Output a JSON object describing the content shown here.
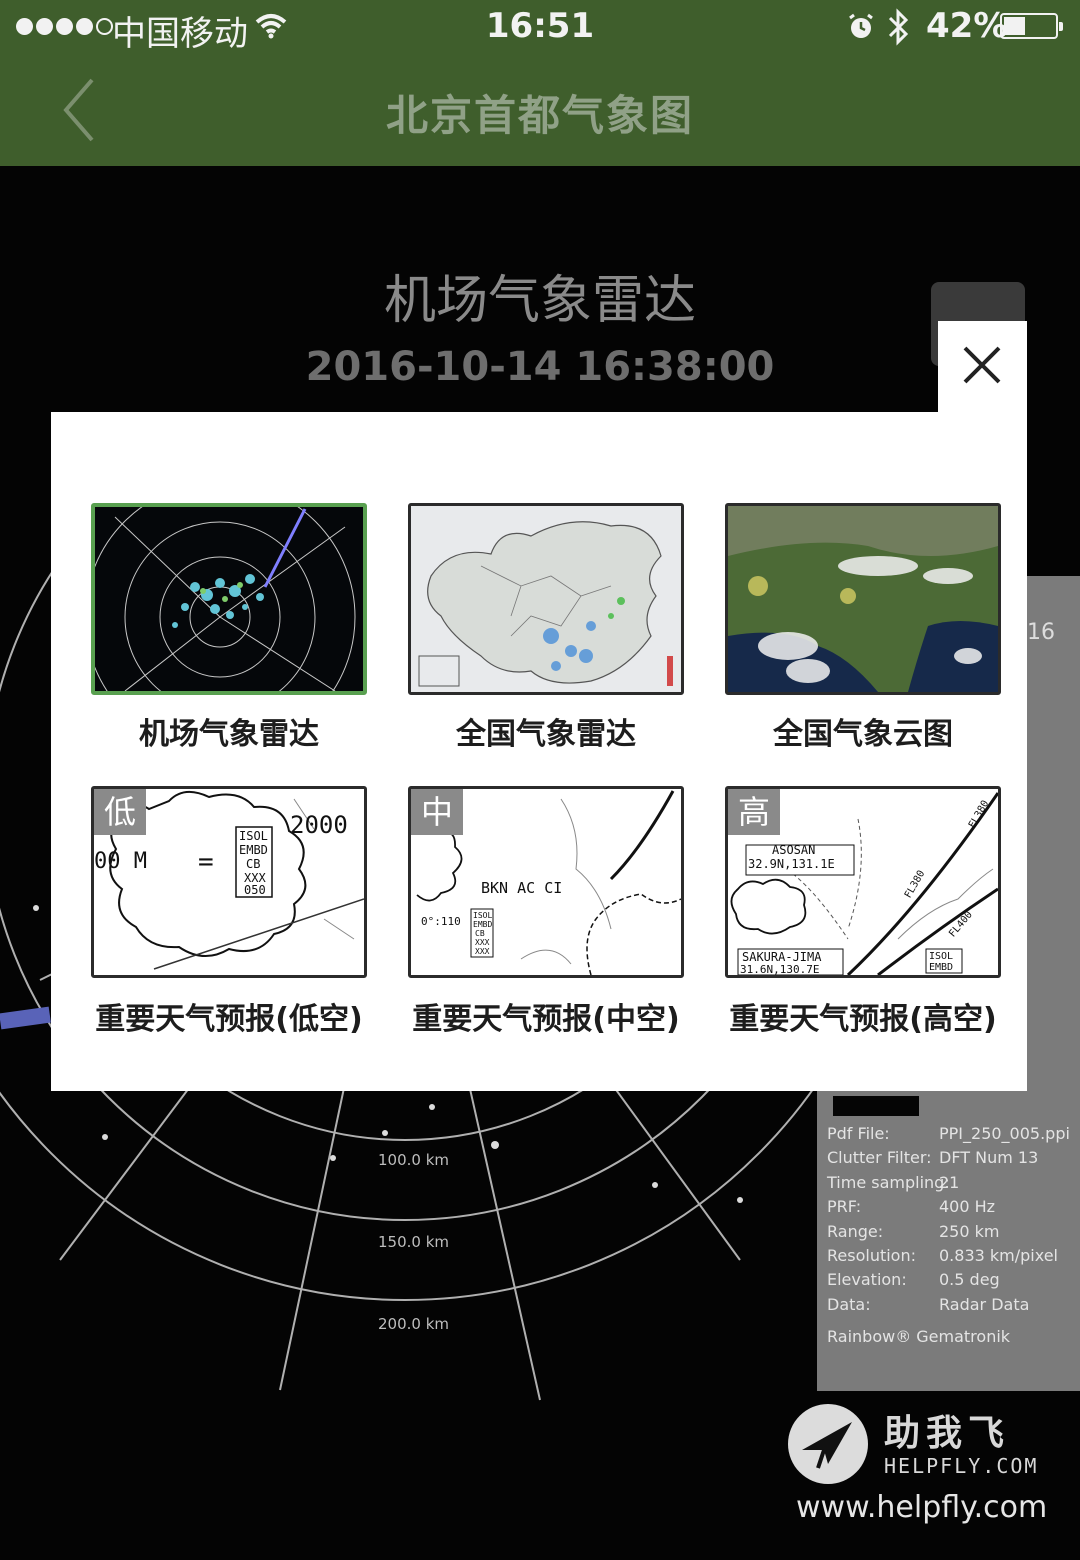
{
  "status_bar": {
    "carrier": "中国移动",
    "time": "16:51",
    "battery_percent_text": "42%",
    "battery_level": 0.42,
    "signal_bars_filled": 4,
    "signal_bars_total": 5
  },
  "nav": {
    "title": "北京首都气象图",
    "back_icon": "chevron-left-icon"
  },
  "background_page": {
    "title": "机场气象雷达",
    "timestamp": "2016-10-14 16:38:00",
    "range_labels": [
      "100.0 km",
      "150.0 km",
      "200.0 km"
    ],
    "info_panel": {
      "partial_number": "16",
      "rows": [
        {
          "key": "Pdf File:",
          "value": "PPI_250_005.ppi"
        },
        {
          "key": "Clutter Filter:",
          "value": "DFT Num 13"
        },
        {
          "key": "Time sampling:",
          "value": "21"
        },
        {
          "key": "PRF:",
          "value": "400 Hz"
        },
        {
          "key": "Range:",
          "value": "250 km"
        },
        {
          "key": "Resolution:",
          "value": "0.833 km/pixel"
        },
        {
          "key": "Elevation:",
          "value": "0.5 deg"
        },
        {
          "key": "Data:",
          "value": "Radar Data"
        }
      ],
      "footer": "Rainbow® Gematronik"
    }
  },
  "modal": {
    "close_icon": "close-icon",
    "items": [
      {
        "label": "机场气象雷达",
        "selected": true,
        "badge": ""
      },
      {
        "label": "全国气象雷达",
        "selected": false,
        "badge": ""
      },
      {
        "label": "全国气象云图",
        "selected": false,
        "badge": ""
      },
      {
        "label": "重要天气预报(低空)",
        "selected": false,
        "badge": "低"
      },
      {
        "label": "重要天气预报(中空)",
        "selected": false,
        "badge": "中"
      },
      {
        "label": "重要天气预报(高空)",
        "selected": false,
        "badge": "高"
      }
    ],
    "chart_texts": {
      "low": {
        "value": "2000",
        "left": "00 M",
        "eq": "=",
        "box": [
          "ISOL",
          "EMBD",
          "CB",
          "XXX",
          "050"
        ]
      },
      "mid": {
        "cloud": "BKN AC CI",
        "coord": "0°:110",
        "box": [
          "ISOL",
          "EMBD",
          "CB",
          "XXX",
          "XXX"
        ]
      },
      "high": {
        "wp1": "ASOSAN",
        "wp1_pos": "32.9N,131.1E",
        "wp2": "SAKURA-JIMA",
        "wp2_pos": "31.6N,130.7E",
        "fl1": "FL380",
        "fl2": "FL380",
        "fl3": "FL400",
        "box": [
          "ISOL",
          "EMBD"
        ]
      }
    }
  },
  "watermark": {
    "name": "助我飞",
    "domain": "HELPFLY.COM",
    "url": "www.helpfly.com"
  }
}
